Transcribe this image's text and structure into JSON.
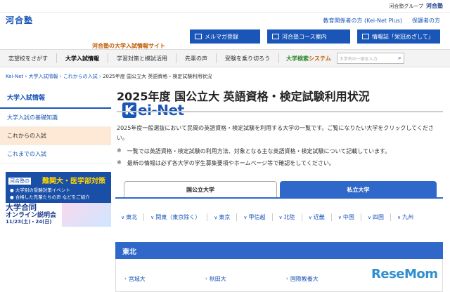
{
  "topbar": {
    "group": "河合塾グループ",
    "brand": "河合塾"
  },
  "logo": {
    "kana": "河合塾",
    "k": "K",
    "name": "ei-Net",
    "tagline": "河合塾の大学入試情報サイト"
  },
  "header_links": [
    "教育関係者の方 (Kei-Net Plus)",
    "保護者の方"
  ],
  "header_buttons": [
    "メルマガ登録",
    "河合塾コース案内",
    "情報誌「栄冠めざして」"
  ],
  "nav": {
    "items": [
      "志望校をさがす",
      "大学入試情報",
      "学習対策と模試活用",
      "先輩の声",
      "受験を乗り切ろう"
    ],
    "system_a": "大学検索",
    "system_b": "システム",
    "search_placeholder": "大学名の一部を入力"
  },
  "breadcrumb": [
    "Kei-Net",
    "大学入試情報",
    "これからの入試",
    "2025年度 国公立大 英語資格・検定試験利用状況"
  ],
  "sidebar": {
    "title": "大学入試情報",
    "items": [
      "大学入試の基礎知識",
      "これからの入試",
      "これまでの入試"
    ]
  },
  "banner1": {
    "tag": "河合塾の",
    "headline": "難関大・医学部対策",
    "line1": "● 大学別の受験対策イベント",
    "line2": "● 合格した先輩たちの声 などをご紹介"
  },
  "banner2": {
    "line1": "大学合同",
    "line2": "オンライン説明会",
    "line3": "11/23(土)・24(日)"
  },
  "main": {
    "title": "2025年度 国公立大 英語資格・検定試験利用状況",
    "intro": "2025年度一般選抜において民間の英語資格・検定試験を利用する大学の一覧です。ご覧になりたい大学をクリックしてください。",
    "notes": [
      "一覧では英語資格・検定試験の利用方法、対象となる主な英語資格・検定試験について記載しています。",
      "最新の情報は必ず各大学の学生募集要項やホームページ等で確認をしてください。"
    ],
    "note_mark": "※"
  },
  "tabs": [
    "国公立大学",
    "私立大学"
  ],
  "regions": [
    "東北",
    "関東（東京除く）",
    "東京",
    "甲信越",
    "北陸",
    "近畿",
    "中国",
    "四国",
    "九州"
  ],
  "section": {
    "title": "東北",
    "schools": [
      "宮城大",
      "秋田大",
      "国際教養大"
    ]
  },
  "watermark": {
    "a": "Rese",
    "b": "Mom"
  }
}
